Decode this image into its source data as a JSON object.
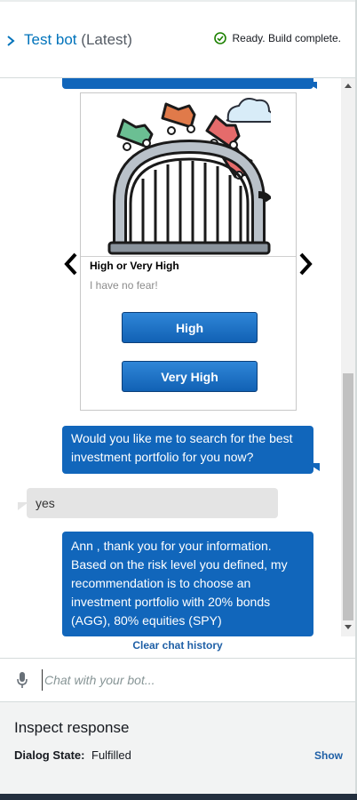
{
  "header": {
    "bot_name": "Test bot",
    "version": "(Latest)",
    "status": "Ready. Build complete."
  },
  "card": {
    "title": "High or Very High",
    "subtitle": "I have no fear!",
    "buttons": [
      "High",
      "Very High"
    ]
  },
  "messages": [
    {
      "from": "bot",
      "text": "Would you like me to search for the best investment portfolio for you now?"
    },
    {
      "from": "user",
      "text": "yes"
    },
    {
      "from": "bot",
      "text": "Ann , thank you for your information. Based on the risk level you defined, my recommendation is to choose an investment portfolio with 20% bonds (AGG), 80% equities (SPY)"
    }
  ],
  "clear_history": "Clear chat history",
  "input": {
    "placeholder": "Chat with your bot..."
  },
  "inspect": {
    "heading": "Inspect response",
    "dialog_state_label": "Dialog State:",
    "dialog_state_value": "Fulfilled",
    "show_label": "Show"
  },
  "colors": {
    "accent": "#0073bb",
    "bot_bubble": "#1166bb",
    "user_bubble": "#e4e4e4",
    "status_ok": "#1d8102",
    "footer": "#232f3e"
  },
  "icons": [
    "chevron-right-icon",
    "check-circle-icon",
    "roller-coaster-image",
    "arrow-left-icon",
    "arrow-right-icon",
    "microphone-icon"
  ]
}
